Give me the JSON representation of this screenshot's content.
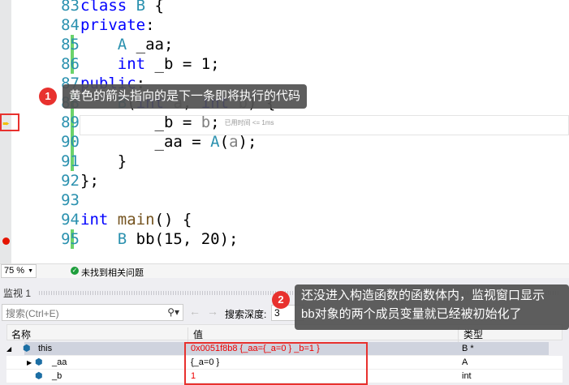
{
  "editor": {
    "lines": [
      {
        "n": "83",
        "code": "class B {"
      },
      {
        "n": "84",
        "code": "private:"
      },
      {
        "n": "85",
        "code": "    A _aa;"
      },
      {
        "n": "86",
        "code": "    int _b = 1;"
      },
      {
        "n": "87",
        "code": "public:"
      },
      {
        "n": "88",
        "code": "    B(int a, int b) {"
      },
      {
        "n": "89",
        "code": "        _b = b;"
      },
      {
        "n": "90",
        "code": "        _aa = A(a);"
      },
      {
        "n": "91",
        "code": "    }"
      },
      {
        "n": "92",
        "code": "};"
      },
      {
        "n": "93",
        "code": ""
      },
      {
        "n": "94",
        "code": "int main() {"
      },
      {
        "n": "95",
        "code": "    B bb(15, 20);"
      }
    ],
    "elapsed": "已用时间 <= 1ms"
  },
  "annotations": {
    "tip1": "黄色的箭头指向的是下一条即将执行的代码",
    "tip1_num": "1",
    "tip2_line1": "还没进入构造函数的函数体内，监视窗口显示",
    "tip2_line2": "bb对象的两个成员变量就已经被初始化了",
    "tip2_num": "2"
  },
  "status": {
    "zoom": "75 %",
    "issues": "未找到相关问题"
  },
  "watch": {
    "title": "监视 1",
    "search_placeholder": "搜索(Ctrl+E)",
    "depth_label": "搜索深度:",
    "depth_value": "3",
    "columns": [
      "名称",
      "值",
      "类型"
    ],
    "rows": [
      {
        "name": "this",
        "value": "0x0051f8b8 {_aa={_a=0 } _b=1 }",
        "type": "B *"
      },
      {
        "name": "_aa",
        "value": "{_a=0 }",
        "type": "A"
      },
      {
        "name": "_b",
        "value": "1",
        "type": "int"
      }
    ]
  }
}
